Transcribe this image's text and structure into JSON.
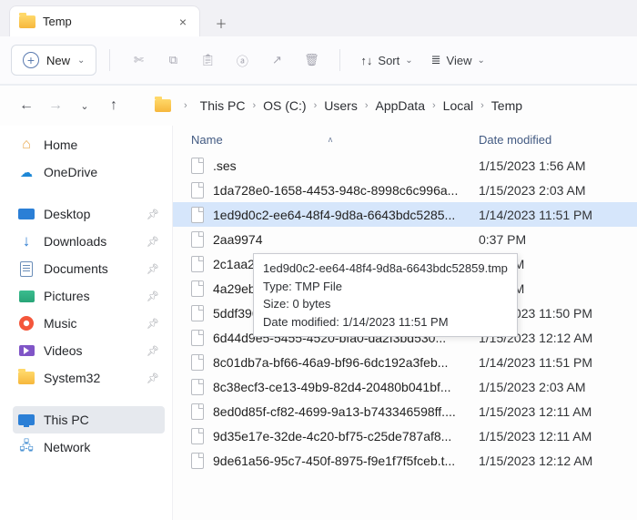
{
  "tab": {
    "title": "Temp"
  },
  "toolbar": {
    "new": "New",
    "sort": "Sort",
    "view": "View"
  },
  "breadcrumbs": [
    "This PC",
    "OS (C:)",
    "Users",
    "AppData",
    "Local",
    "Temp"
  ],
  "sidebar": {
    "home": "Home",
    "onedrive": "OneDrive",
    "items": [
      {
        "label": "Desktop"
      },
      {
        "label": "Downloads"
      },
      {
        "label": "Documents"
      },
      {
        "label": "Pictures"
      },
      {
        "label": "Music"
      },
      {
        "label": "Videos"
      },
      {
        "label": "System32"
      }
    ],
    "thispc": "This PC",
    "network": "Network"
  },
  "columns": {
    "name": "Name",
    "date": "Date modified"
  },
  "files": [
    {
      "name": ".ses",
      "date": "1/15/2023 1:56 AM"
    },
    {
      "name": "1da728e0-1658-4453-948c-8998c6c996a...",
      "date": "1/15/2023 2:03 AM"
    },
    {
      "name": "1ed9d0c2-ee64-48f4-9d8a-6643bdc5285...",
      "date": "1/14/2023 11:51 PM",
      "selected": true
    },
    {
      "name": "2aa9974",
      "date": "0:37 PM"
    },
    {
      "name": "2c1aa22",
      "date": "2:11 AM"
    },
    {
      "name": "4a29eb9",
      "date": "1:11 AM"
    },
    {
      "name": "5ddf396d-f9d3-444f-9211-960a269d559...",
      "date": "1/14/2023 11:50 PM"
    },
    {
      "name": "6d44d9e5-5455-4520-bfa0-da2f3bd530...",
      "date": "1/15/2023 12:12 AM"
    },
    {
      "name": "8c01db7a-bf66-46a9-bf96-6dc192a3feb...",
      "date": "1/14/2023 11:51 PM"
    },
    {
      "name": "8c38ecf3-ce13-49b9-82d4-20480b041bf...",
      "date": "1/15/2023 2:03 AM"
    },
    {
      "name": "8ed0d85f-cf82-4699-9a13-b743346598ff....",
      "date": "1/15/2023 12:11 AM"
    },
    {
      "name": "9d35e17e-32de-4c20-bf75-c25de787af8...",
      "date": "1/15/2023 12:11 AM"
    },
    {
      "name": "9de61a56-95c7-450f-8975-f9e1f7f5fceb.t...",
      "date": "1/15/2023 12:12 AM"
    }
  ],
  "tooltip": {
    "line1": "1ed9d0c2-ee64-48f4-9d8a-6643bdc52859.tmp",
    "line2": "Type: TMP File",
    "line3": "Size: 0 bytes",
    "line4": "Date modified: 1/14/2023 11:51 PM"
  }
}
